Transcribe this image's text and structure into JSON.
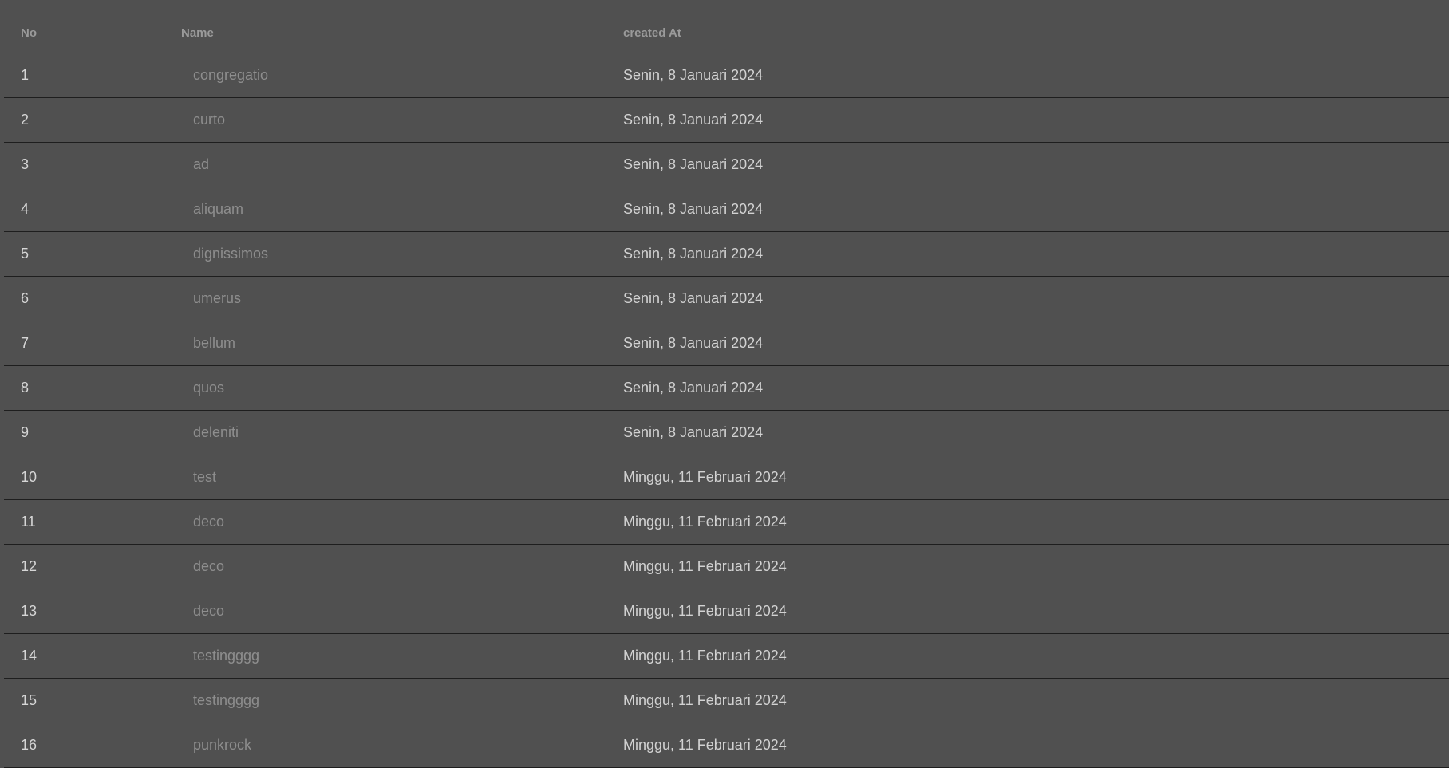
{
  "table": {
    "headers": {
      "no": "No",
      "name": "Name",
      "created_at": "created At"
    },
    "rows": [
      {
        "no": "1",
        "name": "congregatio",
        "created_at": "Senin, 8 Januari 2024"
      },
      {
        "no": "2",
        "name": "curto",
        "created_at": "Senin, 8 Januari 2024"
      },
      {
        "no": "3",
        "name": "ad",
        "created_at": "Senin, 8 Januari 2024"
      },
      {
        "no": "4",
        "name": "aliquam",
        "created_at": "Senin, 8 Januari 2024"
      },
      {
        "no": "5",
        "name": "dignissimos",
        "created_at": "Senin, 8 Januari 2024"
      },
      {
        "no": "6",
        "name": "umerus",
        "created_at": "Senin, 8 Januari 2024"
      },
      {
        "no": "7",
        "name": "bellum",
        "created_at": "Senin, 8 Januari 2024"
      },
      {
        "no": "8",
        "name": "quos",
        "created_at": "Senin, 8 Januari 2024"
      },
      {
        "no": "9",
        "name": "deleniti",
        "created_at": "Senin, 8 Januari 2024"
      },
      {
        "no": "10",
        "name": "test",
        "created_at": "Minggu, 11 Februari 2024"
      },
      {
        "no": "11",
        "name": "deco",
        "created_at": "Minggu, 11 Februari 2024"
      },
      {
        "no": "12",
        "name": "deco",
        "created_at": "Minggu, 11 Februari 2024"
      },
      {
        "no": "13",
        "name": "deco",
        "created_at": "Minggu, 11 Februari 2024"
      },
      {
        "no": "14",
        "name": "testingggg",
        "created_at": "Minggu, 11 Februari 2024"
      },
      {
        "no": "15",
        "name": "testingggg",
        "created_at": "Minggu, 11 Februari 2024"
      },
      {
        "no": "16",
        "name": "punkrock",
        "created_at": "Minggu, 11 Februari 2024"
      }
    ]
  }
}
